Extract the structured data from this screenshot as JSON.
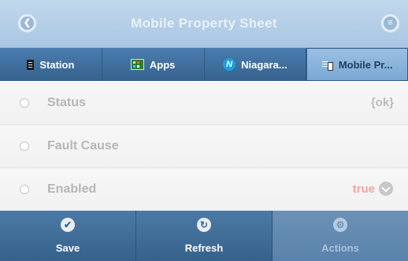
{
  "header": {
    "title": "Mobile Property Sheet",
    "back_icon": "chevron-left-icon",
    "menu_icon": "menu-icon"
  },
  "tabs": [
    {
      "label": "Station",
      "icon": "station-icon"
    },
    {
      "label": "Apps",
      "icon": "apps-icon"
    },
    {
      "label": "Niagara...",
      "icon": "niagara-icon"
    },
    {
      "label": "Mobile Pr...",
      "icon": "mobile-property-icon",
      "active": true
    }
  ],
  "rows": [
    {
      "label": "Status",
      "value": "{ok}"
    },
    {
      "label": "Fault Cause",
      "value": ""
    },
    {
      "label": "Enabled",
      "value": "true",
      "value_color": "#f4a3a3"
    }
  ],
  "footer": [
    {
      "label": "Save",
      "icon": "check-icon"
    },
    {
      "label": "Refresh",
      "icon": "refresh-icon"
    },
    {
      "label": "Actions",
      "icon": "gear-icon",
      "disabled": true
    }
  ],
  "colors": {
    "header": "#a9c6e2",
    "tab_bar": "#3f6f9c",
    "active_tab": "#8fb6dc",
    "footer": "#3e6c97"
  }
}
